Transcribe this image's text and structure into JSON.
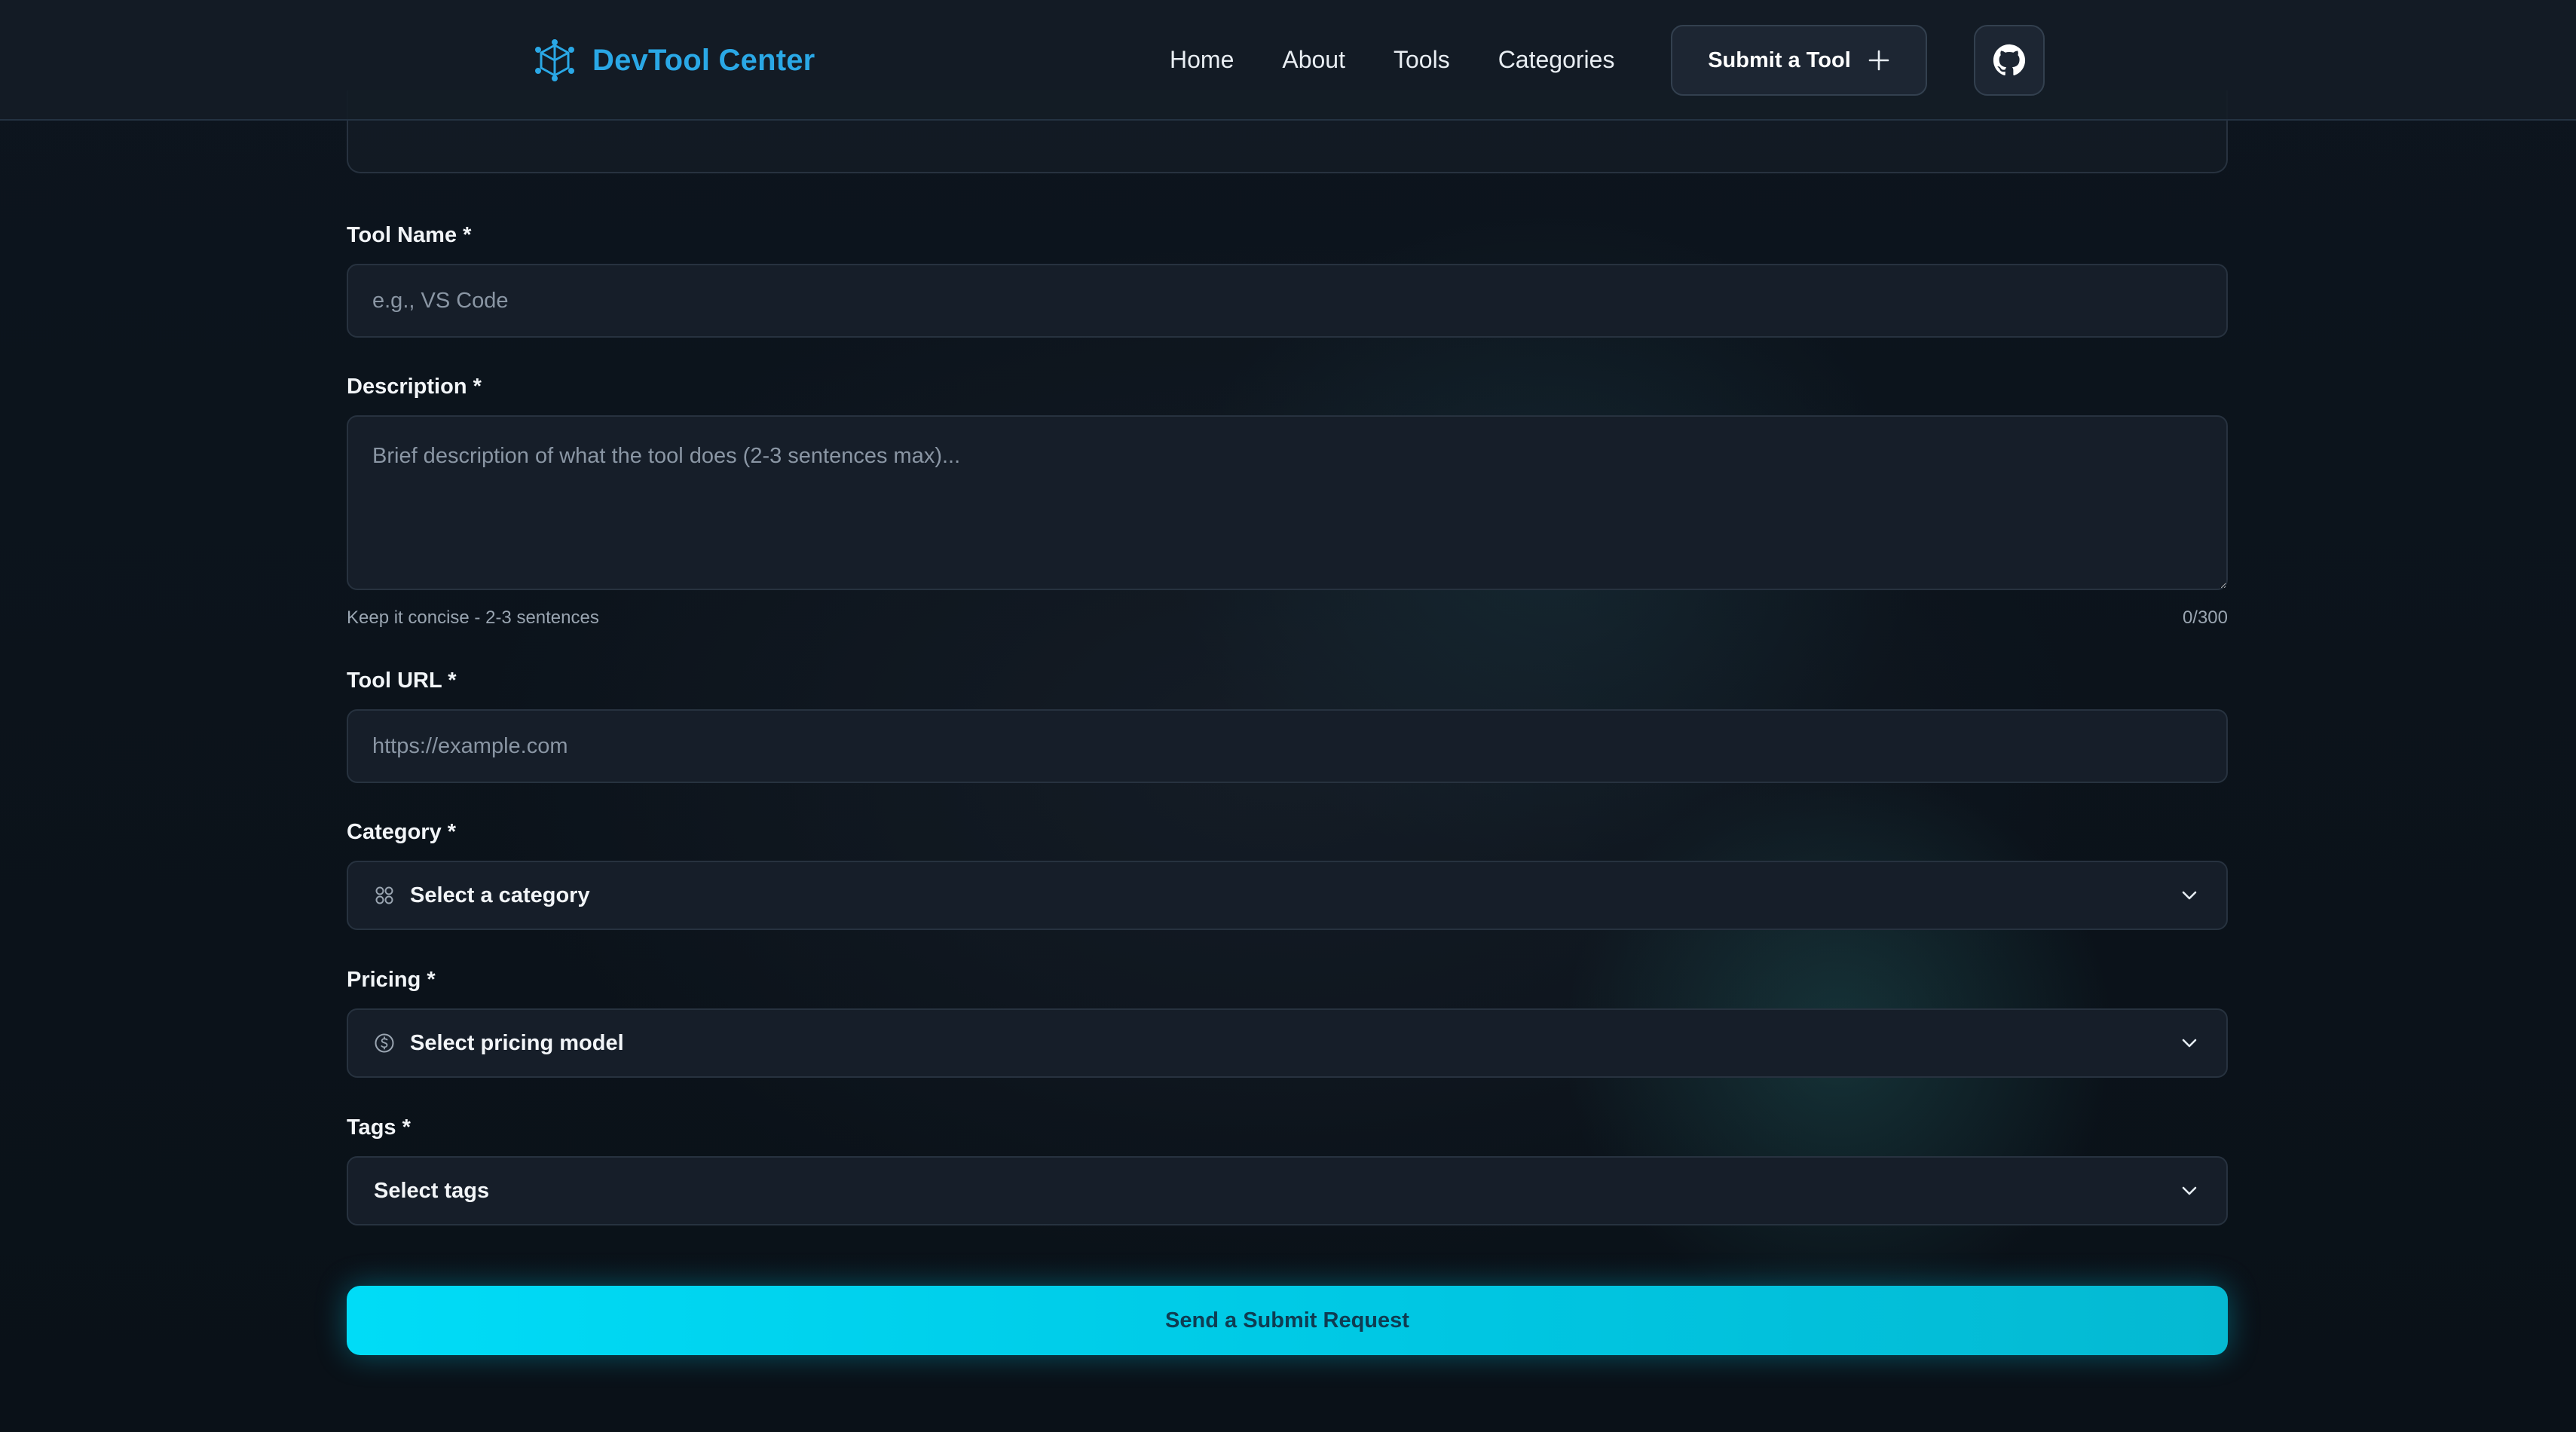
{
  "header": {
    "brand": "DevTool Center",
    "nav": [
      "Home",
      "About",
      "Tools",
      "Categories"
    ],
    "submit_label": "Submit a Tool",
    "brand_color": "#2aa8e6"
  },
  "form": {
    "tool_name": {
      "label": "Tool Name *",
      "placeholder": "e.g., VS Code",
      "value": ""
    },
    "description": {
      "label": "Description *",
      "placeholder": "Brief description of what the tool does (2-3 sentences max)...",
      "value": "",
      "hint": "Keep it concise - 2-3 sentences",
      "counter": "0/300"
    },
    "tool_url": {
      "label": "Tool URL *",
      "placeholder": "https://example.com",
      "value": ""
    },
    "category": {
      "label": "Category *",
      "selected": "Select a category"
    },
    "pricing": {
      "label": "Pricing *",
      "selected": "Select pricing model"
    },
    "tags": {
      "label": "Tags *",
      "selected": "Select tags"
    },
    "submit_label": "Send a Submit Request",
    "accent_color": "#00d4ee"
  }
}
